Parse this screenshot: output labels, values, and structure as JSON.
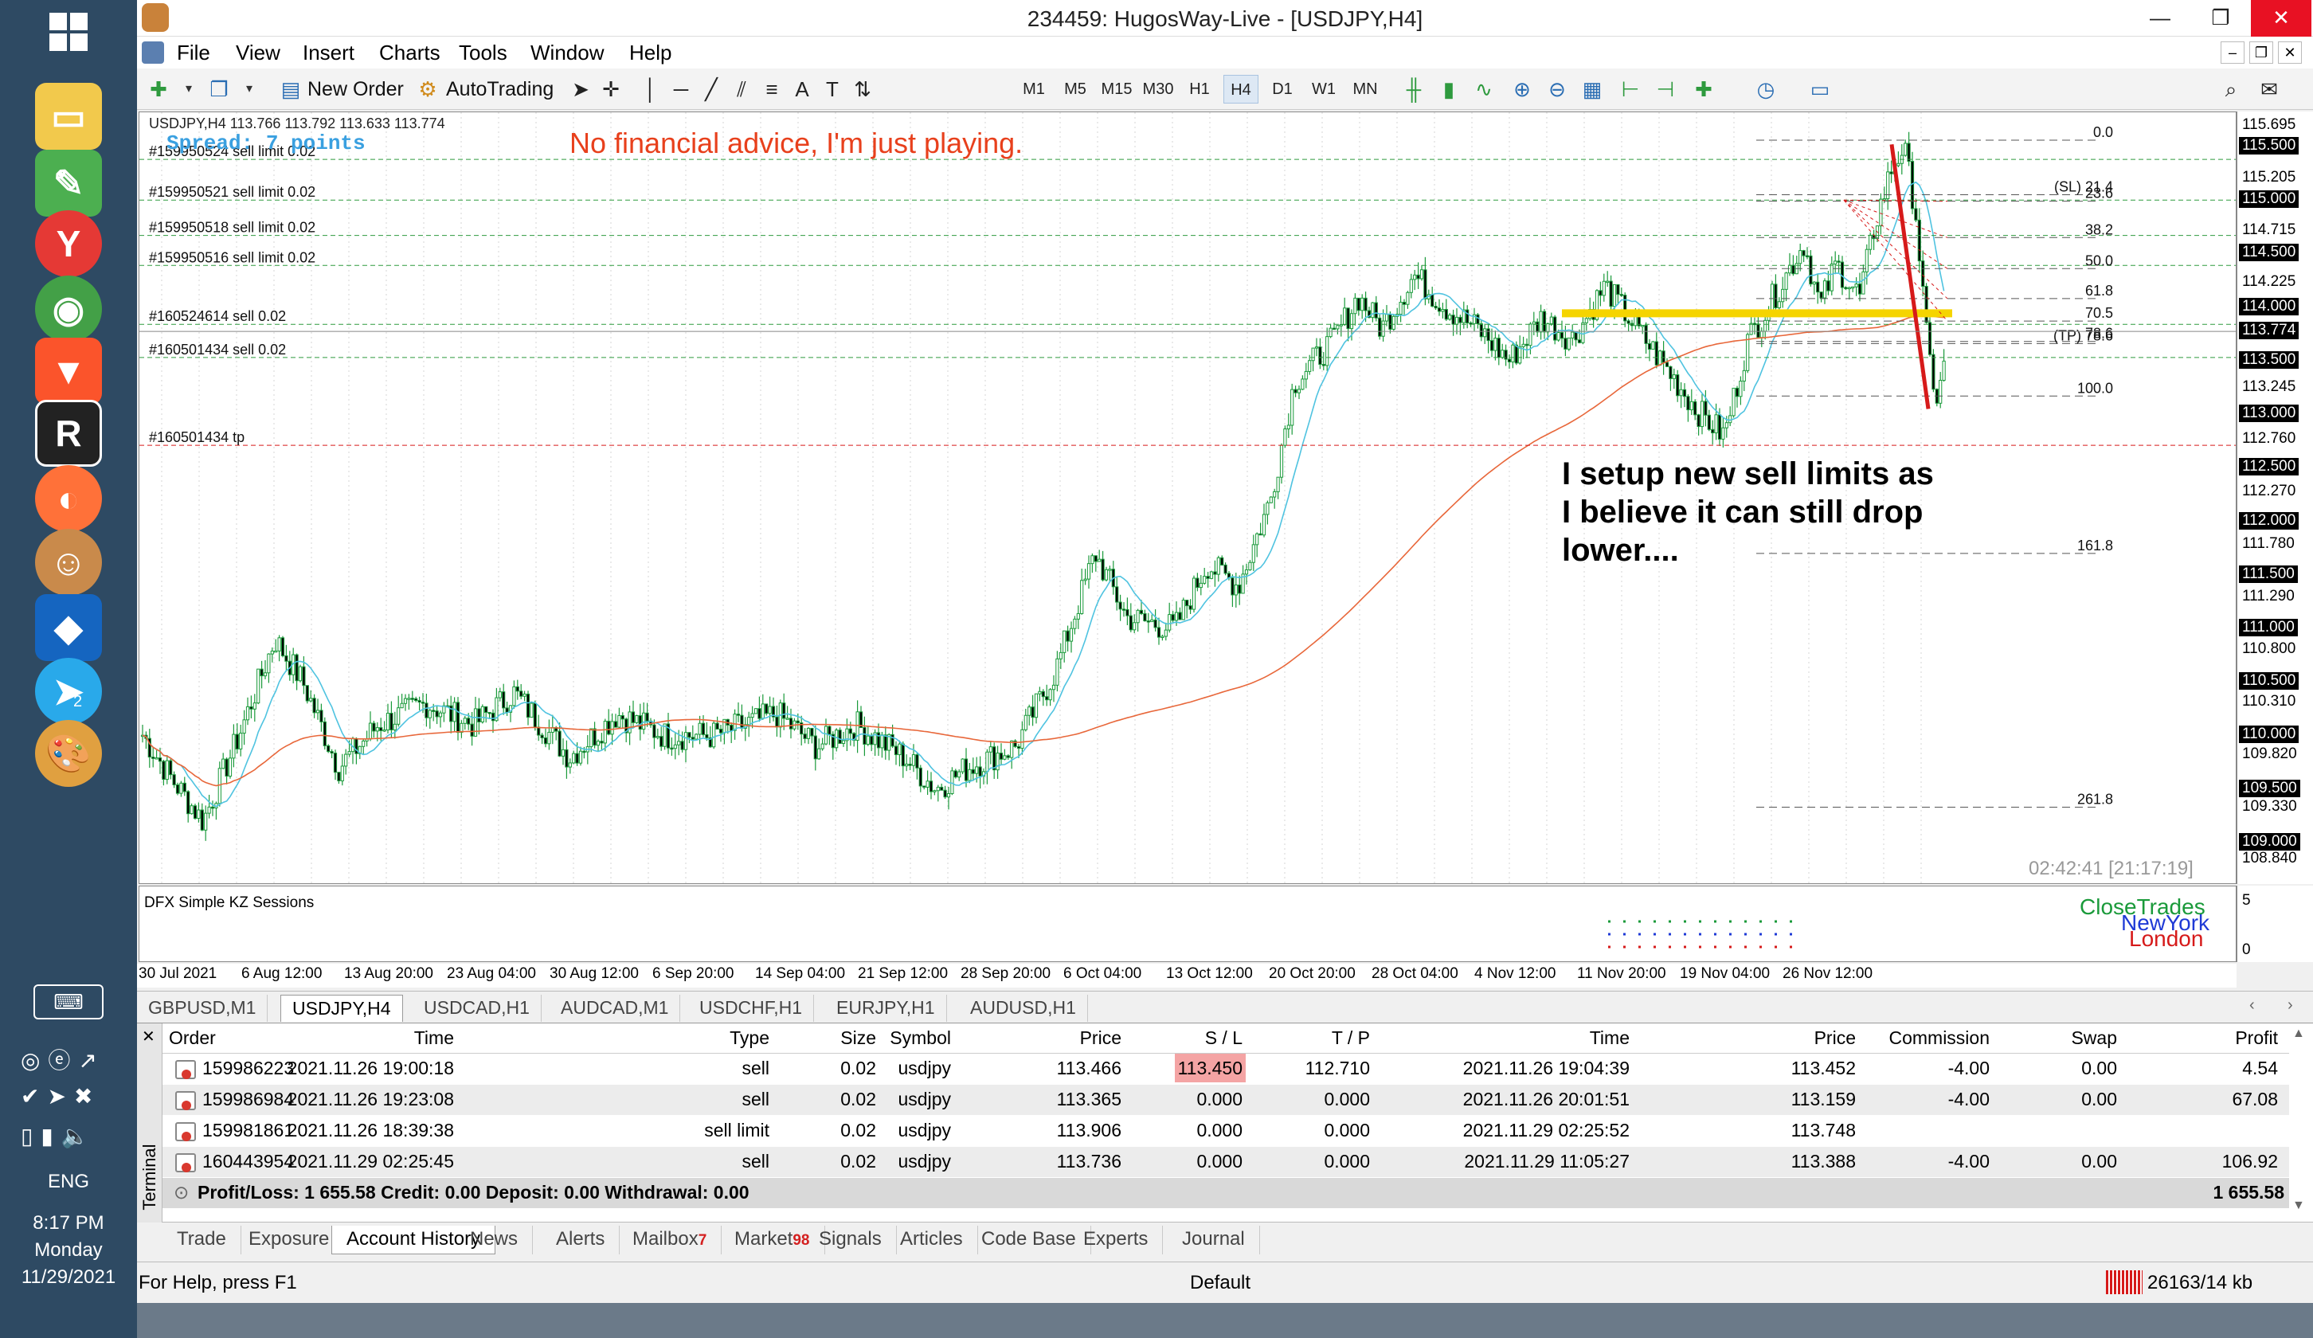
{
  "taskbar": {
    "lang": "ENG",
    "time": "8:17 PM",
    "day": "Monday",
    "date": "11/29/2021",
    "telegram_badge": "2"
  },
  "window": {
    "title": "234459: HugosWay-Live - [USDJPY,H4]",
    "min": "—",
    "restore": "❐",
    "close": "✕"
  },
  "menu": [
    "File",
    "View",
    "Insert",
    "Charts",
    "Tools",
    "Window",
    "Help"
  ],
  "toolbar": {
    "new_order": "New Order",
    "autotrading": "AutoTrading",
    "timeframes": [
      "M1",
      "M5",
      "M15",
      "M30",
      "H1",
      "H4",
      "D1",
      "W1",
      "MN"
    ],
    "active_timeframe": "H4"
  },
  "chart": {
    "header": "USDJPY,H4  113.766 113.792 113.633 113.774",
    "spread": "Spread: 7 points",
    "note": "No financial advice, I'm just playing.",
    "annotation": [
      "I setup new sell limits as",
      "I believe it can still drop",
      "lower...."
    ],
    "clock": "02:42:41 [21:17:19]",
    "order_labels": [
      {
        "text": "#159950524 sell limit 0.02",
        "price": 115.38
      },
      {
        "text": "#159950521 sell limit 0.02",
        "price": 115.0
      },
      {
        "text": "#159950518 sell limit 0.02",
        "price": 114.67
      },
      {
        "text": "#159950516 sell limit 0.02",
        "price": 114.39
      },
      {
        "text": "#160524614 sell 0.02",
        "price": 113.84
      },
      {
        "text": "#160501434 sell 0.02",
        "price": 113.53
      },
      {
        "text": "#160501434 tp",
        "price": 112.71
      }
    ],
    "fib_levels": [
      {
        "label": "0.0",
        "price": 115.56
      },
      {
        "label": "(SL) 21.4",
        "price": 115.05
      },
      {
        "label": "23.6",
        "price": 114.99
      },
      {
        "label": "38.2",
        "price": 114.65
      },
      {
        "label": "50.0",
        "price": 114.36
      },
      {
        "label": "61.8",
        "price": 114.08
      },
      {
        "label": "70.5",
        "price": 113.87
      },
      {
        "label": "78.6",
        "price": 113.68
      },
      {
        "label": "(TP) 78.6",
        "price": 113.66
      },
      {
        "label": "100.0",
        "price": 113.17
      },
      {
        "label": "161.8",
        "price": 111.7
      },
      {
        "label": "261.8",
        "price": 109.33
      }
    ],
    "price_labels": [
      {
        "text": "115.695",
        "box": false
      },
      {
        "text": "115.500",
        "box": true
      },
      {
        "text": "115.205",
        "box": false
      },
      {
        "text": "115.000",
        "box": true
      },
      {
        "text": "114.715",
        "box": false
      },
      {
        "text": "114.500",
        "box": true
      },
      {
        "text": "114.225",
        "box": false
      },
      {
        "text": "114.000",
        "box": true
      },
      {
        "text": "113.774",
        "box": true
      },
      {
        "text": "113.500",
        "box": true
      },
      {
        "text": "113.245",
        "box": false
      },
      {
        "text": "113.000",
        "box": true
      },
      {
        "text": "112.760",
        "box": false
      },
      {
        "text": "112.500",
        "box": true
      },
      {
        "text": "112.270",
        "box": false
      },
      {
        "text": "112.000",
        "box": true
      },
      {
        "text": "111.780",
        "box": false
      },
      {
        "text": "111.500",
        "box": true
      },
      {
        "text": "111.290",
        "box": false
      },
      {
        "text": "111.000",
        "box": true
      },
      {
        "text": "110.800",
        "box": false
      },
      {
        "text": "110.500",
        "box": true
      },
      {
        "text": "110.310",
        "box": false
      },
      {
        "text": "110.000",
        "box": true
      },
      {
        "text": "109.820",
        "box": false
      },
      {
        "text": "109.500",
        "box": true
      },
      {
        "text": "109.330",
        "box": false
      },
      {
        "text": "109.000",
        "box": true
      },
      {
        "text": "108.840",
        "box": false
      }
    ],
    "dates": [
      "30 Jul 2021",
      "6 Aug 12:00",
      "13 Aug 20:00",
      "23 Aug 04:00",
      "30 Aug 12:00",
      "6 Sep 20:00",
      "14 Sep 04:00",
      "21 Sep 12:00",
      "28 Sep 20:00",
      "6 Oct 04:00",
      "13 Oct 12:00",
      "20 Oct 20:00",
      "28 Oct 04:00",
      "4 Nov 12:00",
      "11 Nov 20:00",
      "19 Nov 04:00",
      "26 Nov 12:00"
    ],
    "indicator": {
      "name": "DFX Simple KZ Sessions",
      "sessions": [
        "CloseTrades",
        "NewYork",
        "London"
      ],
      "scale_top": "5",
      "scale_bottom": "0"
    },
    "colors": {
      "bull": "#1a9a3a",
      "ma_fast": "#4fc3e0",
      "ma_slow": "#e8673a",
      "highlight": "#f5d400",
      "arrow": "#d61a1a",
      "note": "#e8401c",
      "spread": "#3aa0e0"
    }
  },
  "symbol_tabs": [
    "GBPUSD,M1",
    "USDJPY,H4",
    "USDCAD,H1",
    "AUDCAD,M1",
    "USDCHF,H1",
    "EURJPY,H1",
    "AUDUSD,H1"
  ],
  "terminal": {
    "side_label": "Terminal",
    "columns": [
      "Order",
      "Time",
      "Type",
      "Size",
      "Symbol",
      "Price",
      "S / L",
      "T / P",
      "Time",
      "Price",
      "Commission",
      "Swap",
      "Profit"
    ],
    "rows": [
      [
        "159986223",
        "2021.11.26 19:00:18",
        "sell",
        "0.02",
        "usdjpy",
        "113.466",
        "113.450",
        "112.710",
        "2021.11.26 19:04:39",
        "113.452",
        "-4.00",
        "0.00",
        "4.54"
      ],
      [
        "159986984",
        "2021.11.26 19:23:08",
        "sell",
        "0.02",
        "usdjpy",
        "113.365",
        "0.000",
        "0.000",
        "2021.11.26 20:01:51",
        "113.159",
        "-4.00",
        "0.00",
        "67.08"
      ],
      [
        "159981861",
        "2021.11.26 18:39:38",
        "sell limit",
        "0.02",
        "usdjpy",
        "113.906",
        "0.000",
        "0.000",
        "2021.11.29 02:25:52",
        "113.748",
        "",
        "",
        ""
      ],
      [
        "160443954",
        "2021.11.29 02:25:45",
        "sell",
        "0.02",
        "usdjpy",
        "113.736",
        "0.000",
        "0.000",
        "2021.11.29 11:05:27",
        "113.388",
        "-4.00",
        "0.00",
        "106.92"
      ]
    ],
    "summary": "Profit/Loss: 1 655.58  Credit: 0.00  Deposit: 0.00  Withdrawal: 0.00",
    "summary_total": "1 655.58"
  },
  "bottom_tabs": [
    {
      "label": "Trade",
      "badge": ""
    },
    {
      "label": "Exposure",
      "badge": ""
    },
    {
      "label": "Account History",
      "badge": ""
    },
    {
      "label": "News",
      "badge": ""
    },
    {
      "label": "Alerts",
      "badge": ""
    },
    {
      "label": "Mailbox",
      "badge": "7"
    },
    {
      "label": "Market",
      "badge": "98"
    },
    {
      "label": "Signals",
      "badge": ""
    },
    {
      "label": "Articles",
      "badge": ""
    },
    {
      "label": "Code Base",
      "badge": ""
    },
    {
      "label": "Experts",
      "badge": ""
    },
    {
      "label": "Journal",
      "badge": ""
    }
  ],
  "status": {
    "help": "For Help, press F1",
    "profile": "Default",
    "traffic": "26163/14 kb"
  }
}
